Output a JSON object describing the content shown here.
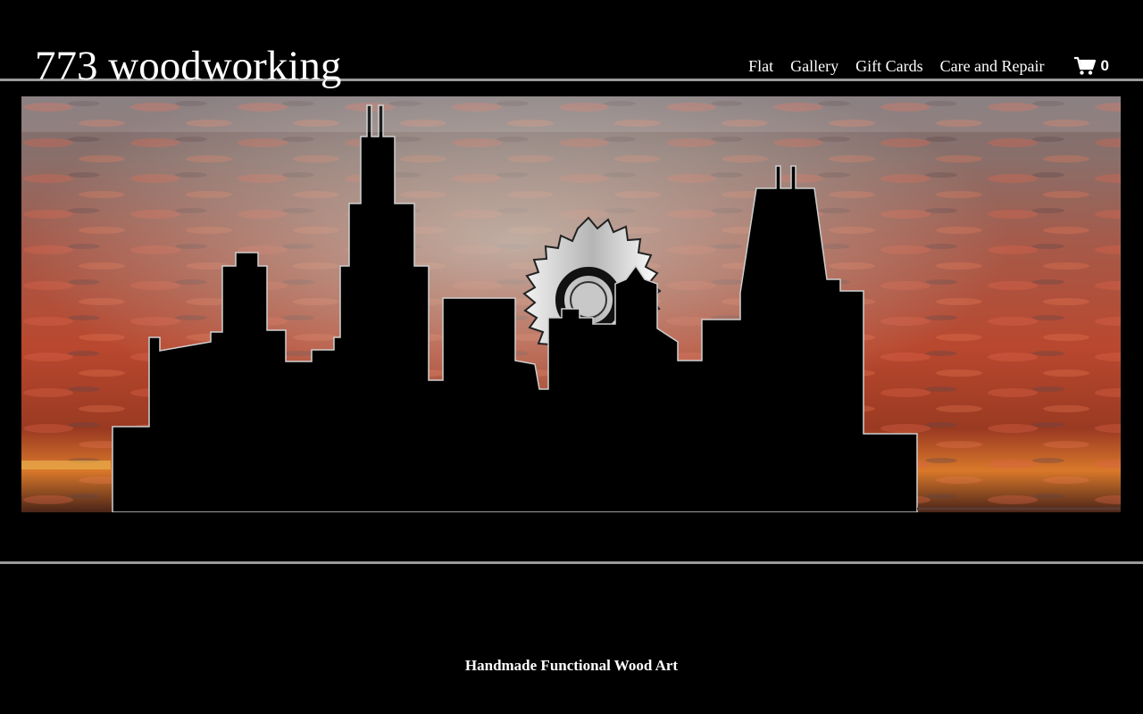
{
  "site": {
    "title": "773 woodworking",
    "tagline": "Handmade Functional Wood Art"
  },
  "nav": {
    "items": [
      {
        "label": "Flat"
      },
      {
        "label": "Gallery"
      },
      {
        "label": "Gift Cards"
      },
      {
        "label": "Care and Repair"
      }
    ],
    "cart": {
      "icon": "shopping-cart-icon",
      "count": "0"
    }
  },
  "banner": {
    "image": "chicago-skyline-saw-blade-sunset",
    "colors": {
      "sky_top": "#7d7677",
      "sky_mid": "#c0503a",
      "sky_low": "#e07a2a",
      "silhouette": "#000000",
      "blade": "#d8d8d8"
    }
  },
  "colors": {
    "background": "#000000",
    "rule": "#9a9a9a",
    "text": "#ffffff"
  }
}
